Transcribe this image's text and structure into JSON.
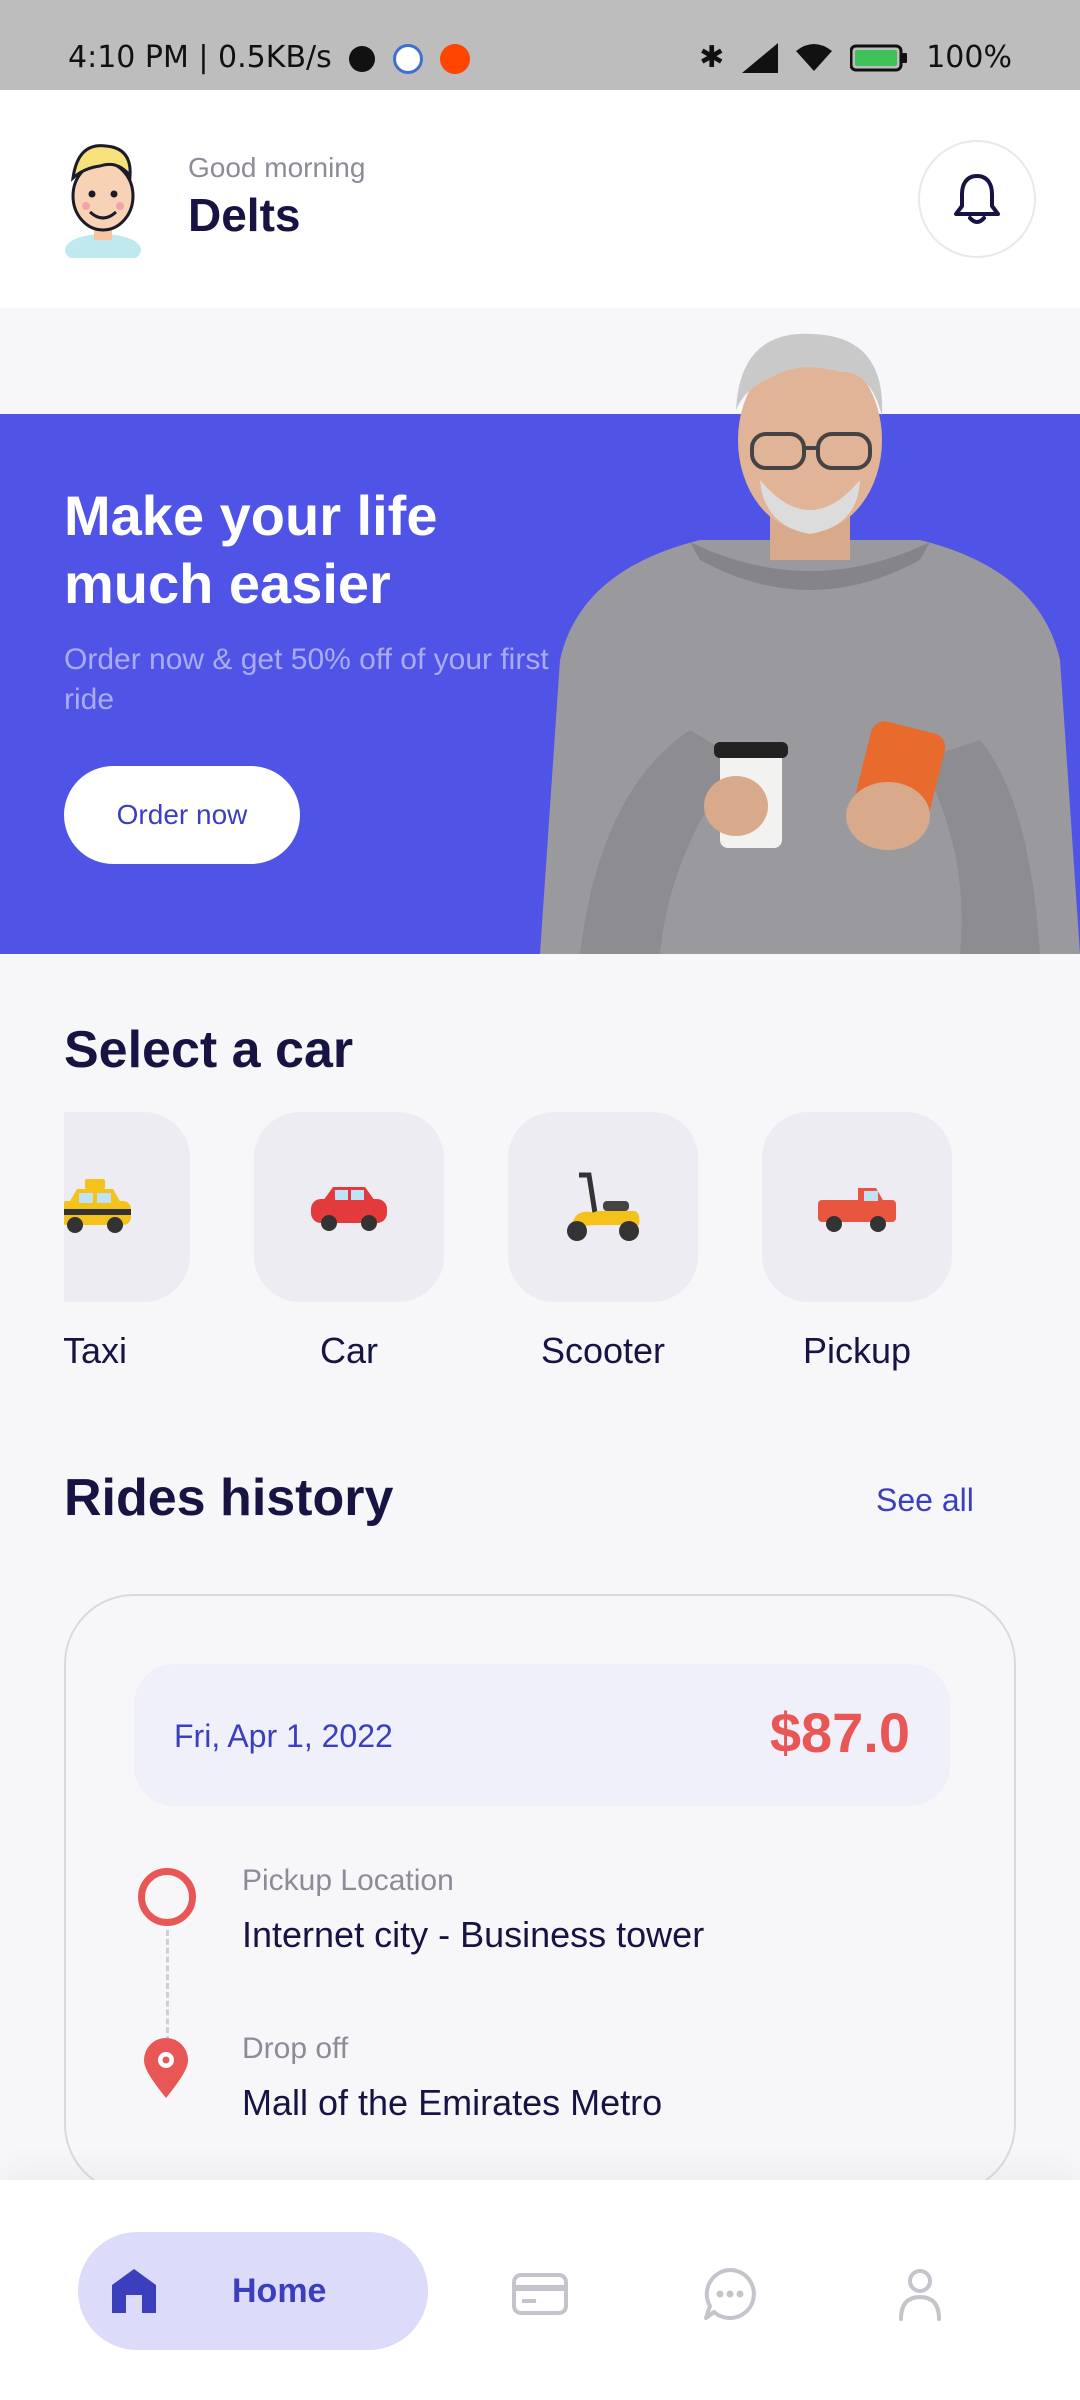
{
  "status_bar": {
    "left_text": "4:10 PM | 0.5KB/s",
    "battery": "100%"
  },
  "header": {
    "greeting": "Good morning",
    "username": "Delts"
  },
  "banner": {
    "title": "Make your life much easier",
    "subtitle": "Order now & get 50% off of your first ride",
    "cta_label": "Order now"
  },
  "select_car": {
    "title": "Select a car",
    "items": [
      {
        "label": "Taxi",
        "icon": "taxi-icon"
      },
      {
        "label": "Car",
        "icon": "car-icon"
      },
      {
        "label": "Scooter",
        "icon": "scooter-icon"
      },
      {
        "label": "Pickup",
        "icon": "pickup-truck-icon"
      }
    ]
  },
  "rides_history": {
    "title": "Rides history",
    "see_all_label": "See all",
    "ride": {
      "date": "Fri, Apr 1, 2022",
      "price": "$87.0",
      "pickup_label": "Pickup Location",
      "pickup_value": "Internet city - Business tower",
      "dropoff_label": "Drop off",
      "dropoff_value": "Mall of the Emirates Metro"
    }
  },
  "bottom_nav": {
    "home_label": "Home",
    "items": [
      "home-icon",
      "card-icon",
      "chat-icon",
      "profile-icon"
    ]
  },
  "colors": {
    "primary": "#5054e6",
    "accent_red": "#e85656",
    "dark_text": "#171443",
    "muted_text": "#8c8c99"
  }
}
